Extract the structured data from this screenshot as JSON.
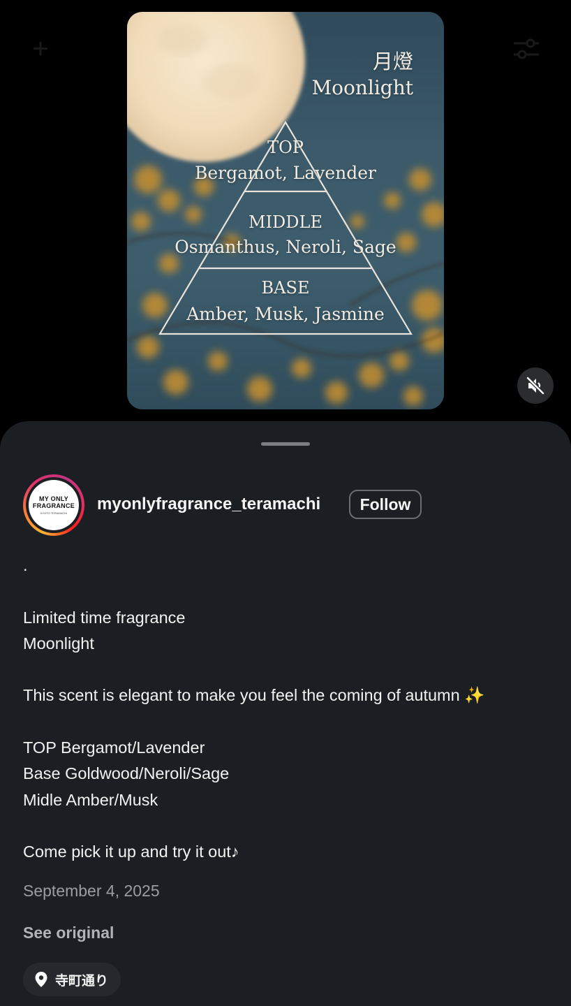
{
  "media": {
    "name_jp": "月燈",
    "name_en": "Moonlight",
    "tiers": [
      {
        "label": "TOP",
        "notes": "Bergamot, Lavender"
      },
      {
        "label": "MIDDLE",
        "notes": "Osmanthus, Neroli, Sage"
      },
      {
        "label": "BASE",
        "notes": "Amber, Musk, Jasmine"
      }
    ]
  },
  "icons": {
    "top_left": "plus-icon",
    "top_right": "filter-icon",
    "mute": "speaker-muted-icon",
    "location": "location-pin-icon"
  },
  "post": {
    "avatar_text": [
      "MY ONLY",
      "FRAGRANCE"
    ],
    "avatar_subtext": "KYOTO TERAMACHI",
    "username": "myonlyfragrance_teramachi",
    "follow_label": "Follow",
    "caption_lines": [
      ".",
      "",
      "Limited time fragrance",
      "Moonlight",
      "",
      "This scent is elegant to make you feel the coming of autumn ✨",
      "",
      "TOP Bergamot/Lavender",
      "Base Goldwood/Neroli/Sage",
      "Midle Amber/Musk",
      "",
      "Come pick it up and try it out♪"
    ],
    "date": "September 4, 2025",
    "see_original": "See original",
    "location": "寺町通り"
  },
  "colors": {
    "sheet_bg": "#1b1f23",
    "text_primary": "#f5f5f5",
    "text_secondary": "#9a9ea4",
    "story_ring": [
      "#f9b233",
      "#e1306c",
      "#c13584"
    ]
  }
}
